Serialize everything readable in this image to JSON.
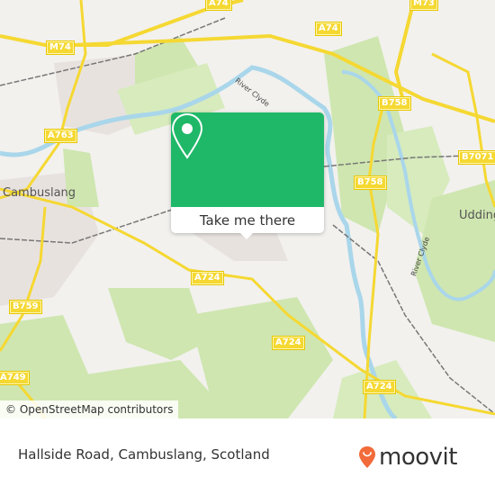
{
  "map": {
    "place_labels": {
      "cambuslang": "Cambuslang",
      "uddingston": "Udding"
    },
    "river_labels": {
      "clyde_north": "River Clyde",
      "clyde_east": "River Clyde"
    },
    "road_shields": {
      "a74_top": "A74",
      "m74": "M74",
      "a74": "A74",
      "m73": "M73",
      "a763": "A763",
      "b758_north": "B758",
      "b758_south": "B758",
      "b7071": "B7071",
      "a724_west": "A724",
      "a724_mid": "A724",
      "a724_east": "A724",
      "b759": "B759",
      "a749": "A749"
    },
    "attribution": "© OpenStreetMap contributors",
    "colors": {
      "land": "#f2f1ee",
      "green": "#cfe6b0",
      "water": "#a9d6ea",
      "road": "#f5d832",
      "urban": "#e8e2df"
    }
  },
  "popup": {
    "icon": "map-pin-icon",
    "button_label": "Take me there",
    "color": "#1fb868"
  },
  "footer": {
    "address": "Hallside Road, Cambuslang, Scotland",
    "logo_text": "moovit",
    "logo_icon": "moovit-pin-smile-icon",
    "logo_color": "#f26b3a"
  }
}
